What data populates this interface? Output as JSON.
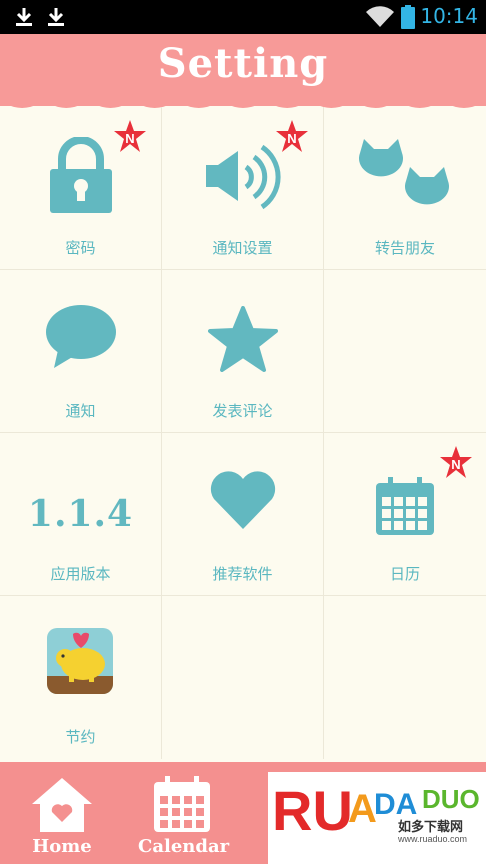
{
  "status_bar": {
    "time": "10:14",
    "icons": [
      "download-icon",
      "download-icon",
      "wifi-icon",
      "battery-icon"
    ]
  },
  "header": {
    "title": "Setting"
  },
  "grid": {
    "items": [
      {
        "label": "密码",
        "icon": "lock-icon",
        "badge": "N"
      },
      {
        "label": "通知设置",
        "icon": "speaker-icon",
        "badge": "N"
      },
      {
        "label": "转告朋友",
        "icon": "cats-icon"
      },
      {
        "label": "通知",
        "icon": "speech-bubble-icon"
      },
      {
        "label": "发表评论",
        "icon": "star-icon"
      },
      {
        "label": "",
        "icon": ""
      },
      {
        "label": "应用版本",
        "icon": "version",
        "value": "1.1.4"
      },
      {
        "label": "推荐软件",
        "icon": "heart-icon"
      },
      {
        "label": "日历",
        "icon": "calendar-icon",
        "badge": "N"
      },
      {
        "label": "节约",
        "icon": "piggy-bank-app-icon"
      },
      {
        "label": "",
        "icon": ""
      },
      {
        "label": "",
        "icon": ""
      }
    ]
  },
  "bottom_nav": {
    "home_label": "Home",
    "calendar_label": "Calendar"
  },
  "watermark": {
    "brand": "RUANDADUO",
    "subtitle": "如多下载网",
    "url": "www.ruaduo.com"
  },
  "colors": {
    "header_bg": "#f79a98",
    "accent_teal": "#62b8c0",
    "badge_red": "#e8303a",
    "page_bg": "#fdfbef"
  }
}
